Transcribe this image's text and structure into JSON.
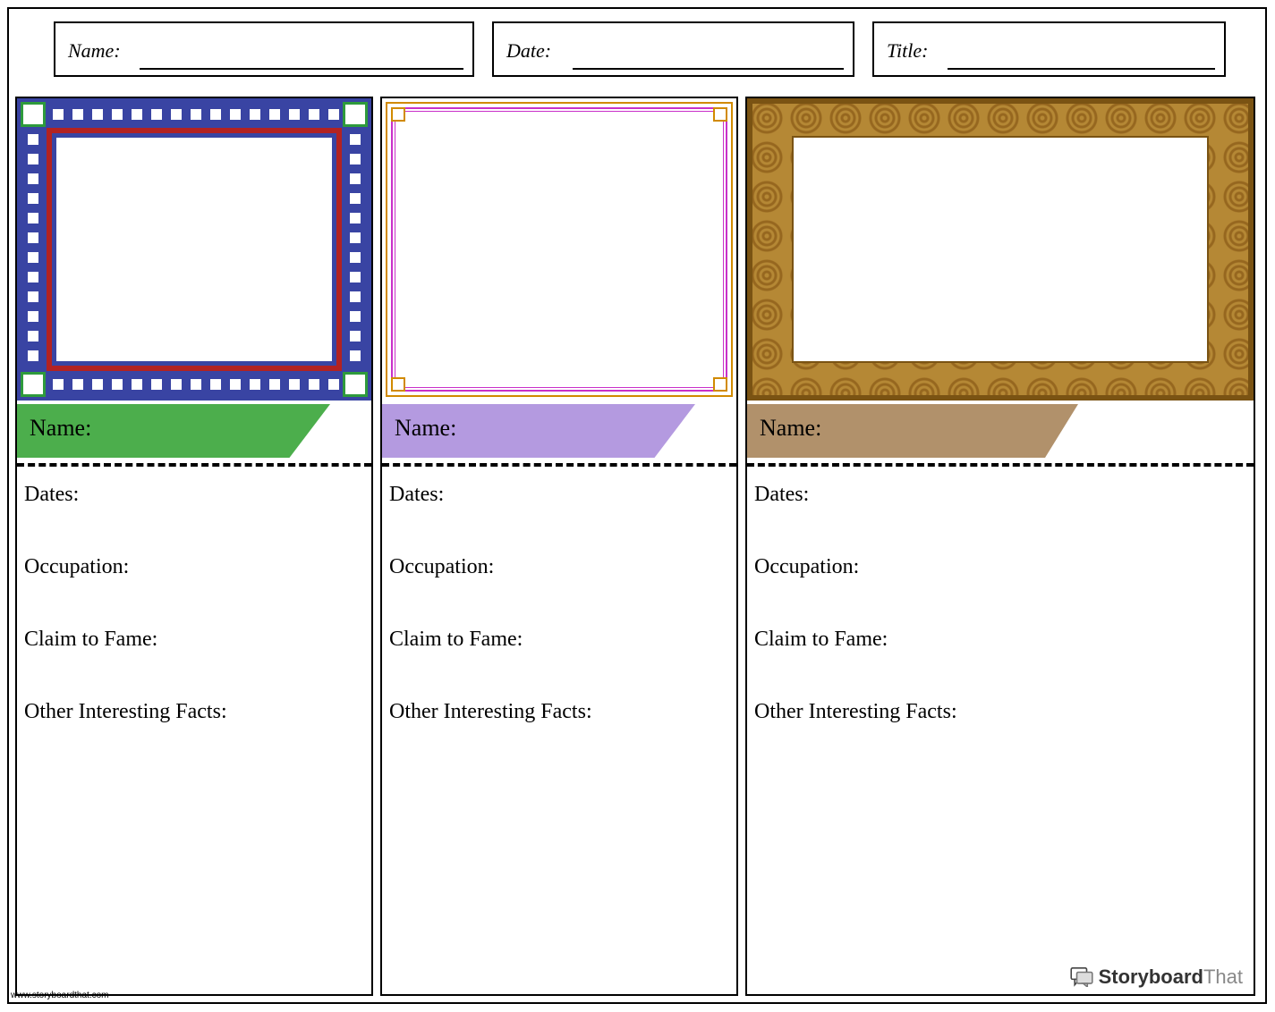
{
  "header": {
    "name_label": "Name:",
    "date_label": "Date:",
    "title_label": "Title:"
  },
  "cards": [
    {
      "banner_label": "Name:",
      "banner_color": "#4cae4c",
      "fields": {
        "dates": "Dates:",
        "occupation": "Occupation:",
        "claim": "Claim to Fame:",
        "other": "Other Interesting Facts:"
      }
    },
    {
      "banner_label": "Name:",
      "banner_color": "#b49ae0",
      "fields": {
        "dates": "Dates:",
        "occupation": "Occupation:",
        "claim": "Claim to Fame:",
        "other": "Other Interesting Facts:"
      }
    },
    {
      "banner_label": "Name:",
      "banner_color": "#b1916b",
      "fields": {
        "dates": "Dates:",
        "occupation": "Occupation:",
        "claim": "Claim to Fame:",
        "other": "Other Interesting Facts:"
      }
    }
  ],
  "footer": {
    "url": "www.storyboardthat.com",
    "brand_a": "Storyboard",
    "brand_b": "That"
  }
}
